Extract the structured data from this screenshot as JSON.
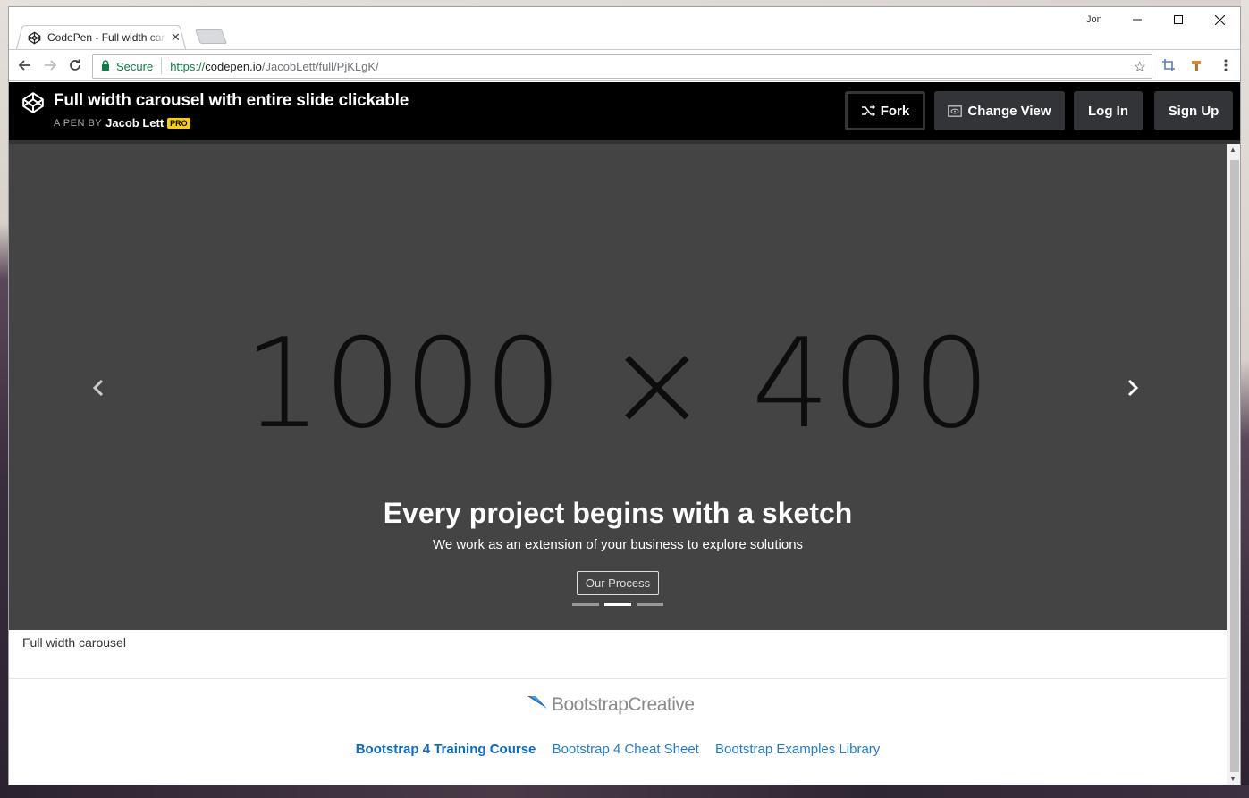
{
  "browser": {
    "tab_title": "CodePen - Full width carousel with entire slide clickable",
    "profile_name": "Jon",
    "secure_label": "Secure",
    "url_scheme": "https://",
    "url_host": "codepen.io",
    "url_path": "/JacobLett/full/PjKLgK/"
  },
  "codepen": {
    "title": "Full width carousel with entire slide clickable",
    "byline_prefix": "A PEN BY",
    "author": "Jacob Lett",
    "badge": "PRO",
    "buttons": {
      "fork": "Fork",
      "change_view": "Change View",
      "log_in": "Log In",
      "sign_up": "Sign Up"
    }
  },
  "carousel": {
    "placeholder_text": "1000 × 400",
    "caption_title": "Every project begins with a sketch",
    "caption_subtitle": "We work as an extension of your business to explore solutions",
    "caption_button": "Our Process",
    "indicator_count": 3,
    "active_indicator": 1,
    "background_color": "#444444"
  },
  "page": {
    "below_text": "Full width carousel",
    "logo_text": "BootstrapCreative",
    "links": [
      {
        "label": "Bootstrap 4 Training Course",
        "bold": true
      },
      {
        "label": "Bootstrap 4 Cheat Sheet",
        "bold": false
      },
      {
        "label": "Bootstrap Examples Library",
        "bold": false
      }
    ]
  },
  "colors": {
    "link": "#1c7cd6",
    "secure_green": "#0b8043",
    "pro_badge": "#fcd000",
    "header_bg": "#000000",
    "button_bg": "#333438"
  },
  "icons": {
    "tab_favicon": "codepen-icon",
    "back": "arrow-left-icon",
    "forward": "arrow-right-icon",
    "reload": "reload-icon",
    "lock": "lock-icon",
    "bookmark": "star-icon",
    "menu": "kebab-menu-icon",
    "fork": "fork-icon",
    "change_view": "eye-icon",
    "prev": "chevron-left-icon",
    "next": "chevron-right-icon"
  }
}
